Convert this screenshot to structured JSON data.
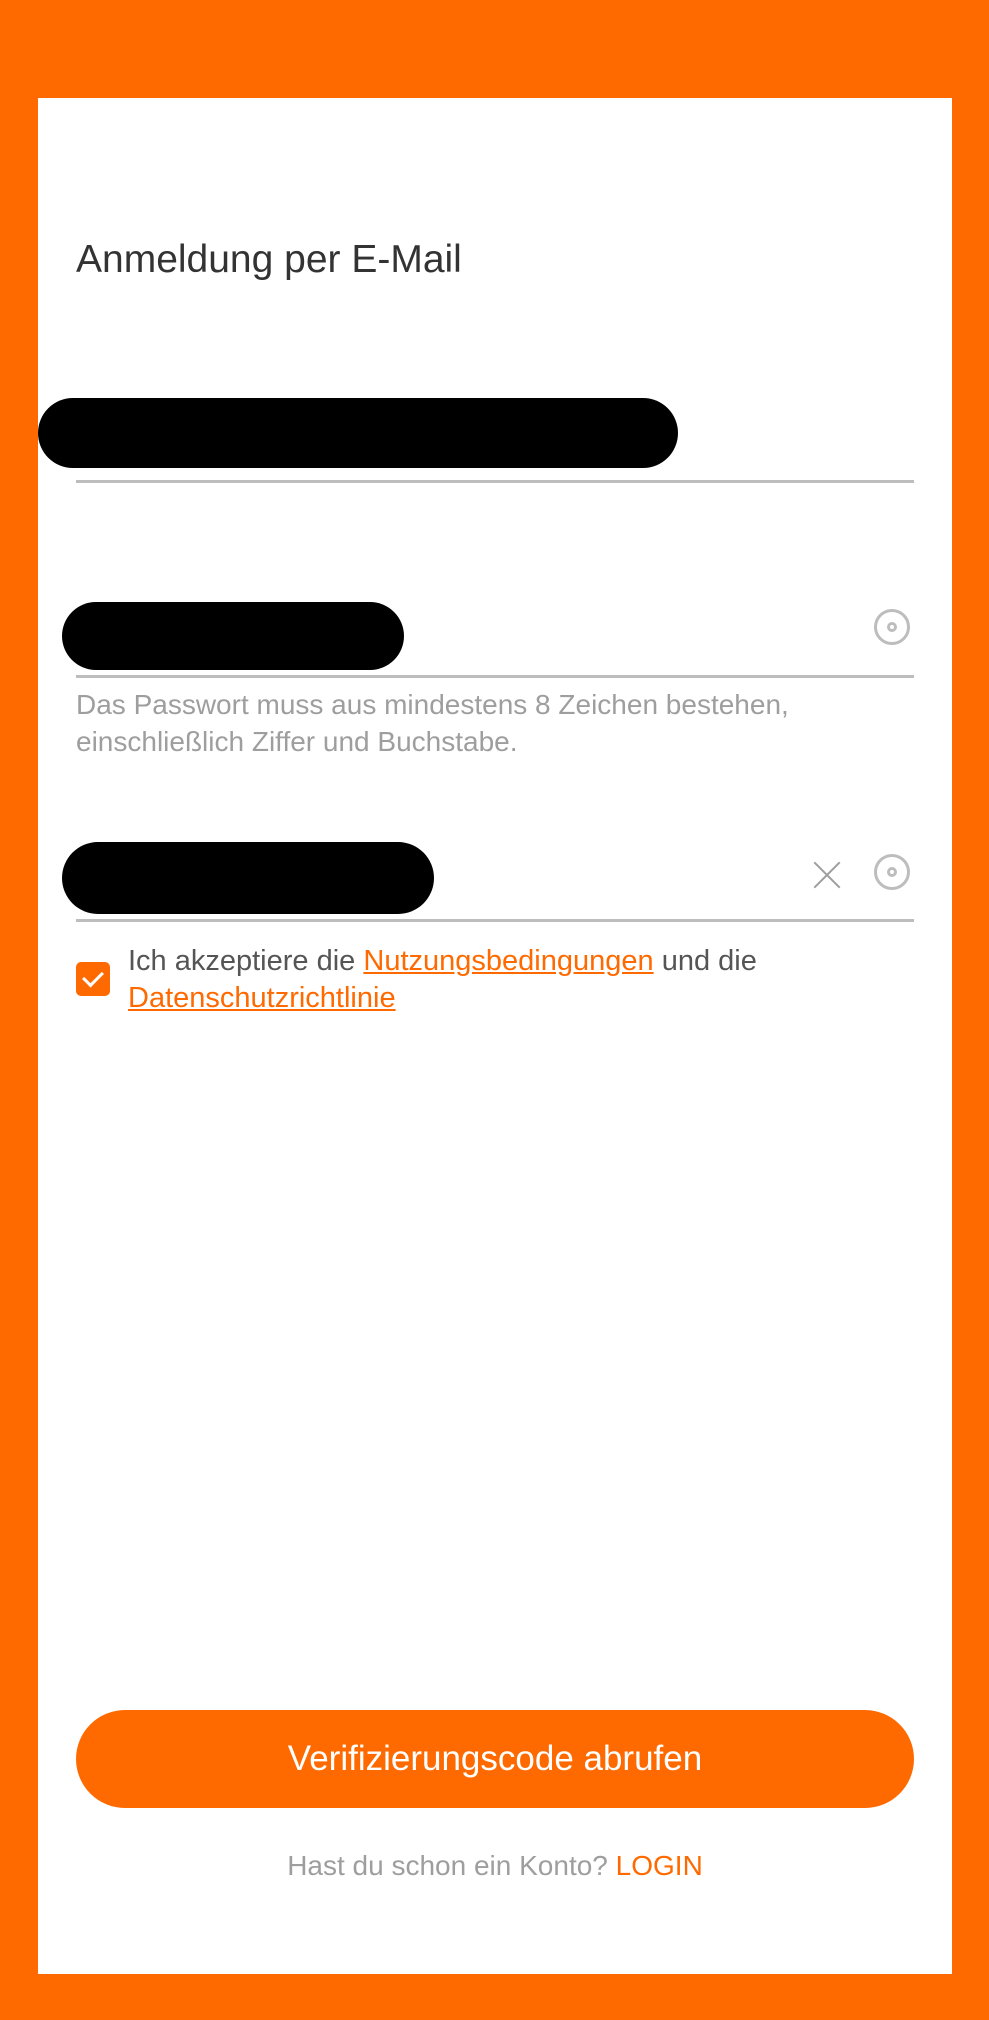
{
  "header": {
    "title": "Anmeldung per E-Mail"
  },
  "form": {
    "email": {
      "value": "[redacted]"
    },
    "password": {
      "value": "[redacted]",
      "hint": "Das Passwort muss aus mindestens 8 Zeichen bestehen, einschließlich Ziffer und Buchstabe.",
      "visibility_icon": "eye-icon"
    },
    "confirm_password": {
      "value": "[redacted]",
      "clear_icon": "close-icon",
      "visibility_icon": "eye-icon"
    },
    "agreement": {
      "checked": true,
      "text_before": "Ich akzeptiere die",
      "terms_link": "Nutzungsbedingungen",
      "text_middle": "und die",
      "privacy_link": "Datenschutzrichtlinie"
    }
  },
  "actions": {
    "primary_label": "Verifizierungscode abrufen"
  },
  "footer": {
    "question": "Hast du schon ein Konto?",
    "login_label": "LOGIN"
  },
  "colors": {
    "accent": "#FF6A00",
    "background": "#FF6A00",
    "card": "#FFFFFF",
    "divider": "#BDBDBD",
    "hint_text": "#9E9E9E"
  }
}
